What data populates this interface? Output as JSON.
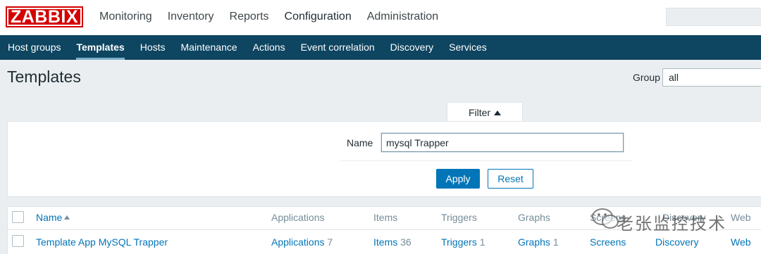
{
  "header": {
    "logo": "ZABBIX",
    "main_menu": [
      "Monitoring",
      "Inventory",
      "Reports",
      "Configuration",
      "Administration"
    ],
    "active_menu": "Configuration"
  },
  "subnav": {
    "items": [
      "Host groups",
      "Templates",
      "Hosts",
      "Maintenance",
      "Actions",
      "Event correlation",
      "Discovery",
      "Services"
    ],
    "active": "Templates"
  },
  "page": {
    "title": "Templates",
    "group_label": "Group",
    "group_value": "all"
  },
  "filter": {
    "tab_label": "Filter",
    "name_label": "Name",
    "name_value": "mysql Trapper",
    "apply_label": "Apply",
    "reset_label": "Reset"
  },
  "table": {
    "columns": [
      "Name",
      "Applications",
      "Items",
      "Triggers",
      "Graphs",
      "Screens",
      "Discovery",
      "Web"
    ],
    "sort_column": "Name",
    "rows": [
      {
        "name": "Template App MySQL Trapper",
        "applications_label": "Applications",
        "applications_count": "7",
        "items_label": "Items",
        "items_count": "36",
        "triggers_label": "Triggers",
        "triggers_count": "1",
        "graphs_label": "Graphs",
        "graphs_count": "1",
        "screens_label": "Screens",
        "discovery_label": "Discovery",
        "web_label": "Web"
      }
    ]
  },
  "watermark": {
    "text": "老张监控技术"
  },
  "colors": {
    "brand_red": "#d40000",
    "nav_bg": "#0e4561",
    "link_blue": "#0275b8",
    "page_bg": "#ebeef0"
  }
}
